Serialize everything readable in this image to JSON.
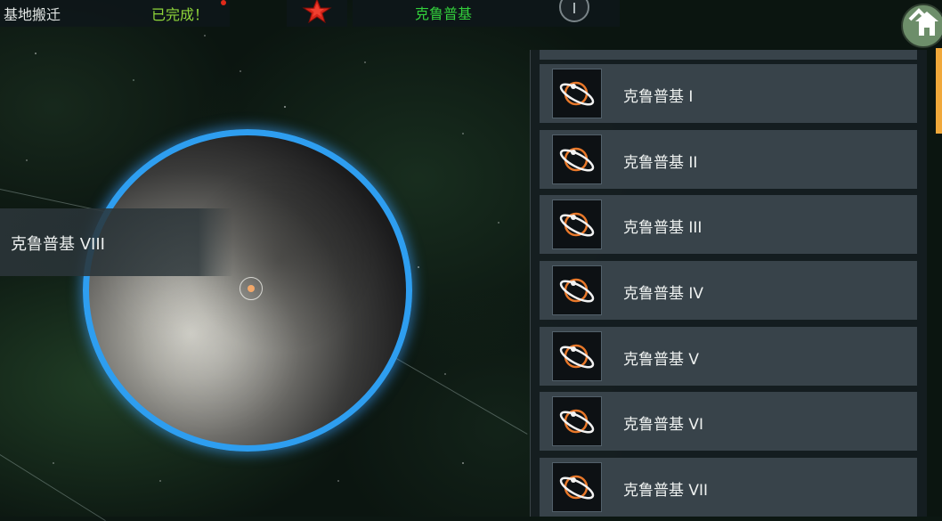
{
  "topbar": {
    "relocation_label": "基地搬迁",
    "relocation_status": "已完成！",
    "selected_planet": "克鲁普基"
  },
  "planet": {
    "name": "克鲁普基 VIII"
  },
  "planet_list": {
    "items": [
      {
        "label": "克鲁普基 I"
      },
      {
        "label": "克鲁普基 II"
      },
      {
        "label": "克鲁普基 III"
      },
      {
        "label": "克鲁普基 IV"
      },
      {
        "label": "克鲁普基 V"
      },
      {
        "label": "克鲁普基 VI"
      },
      {
        "label": "克鲁普基 VII"
      }
    ]
  },
  "colors": {
    "status_green": "#8fd63a",
    "title_green": "#33d03c",
    "planet_ring_blue": "#2e9ef0",
    "scroll_accent": "#f0a83a",
    "notification_red": "#e02a1a"
  },
  "icons": [
    "red-star-icon",
    "info-icon",
    "home-icon",
    "ringed-planet-icon"
  ]
}
